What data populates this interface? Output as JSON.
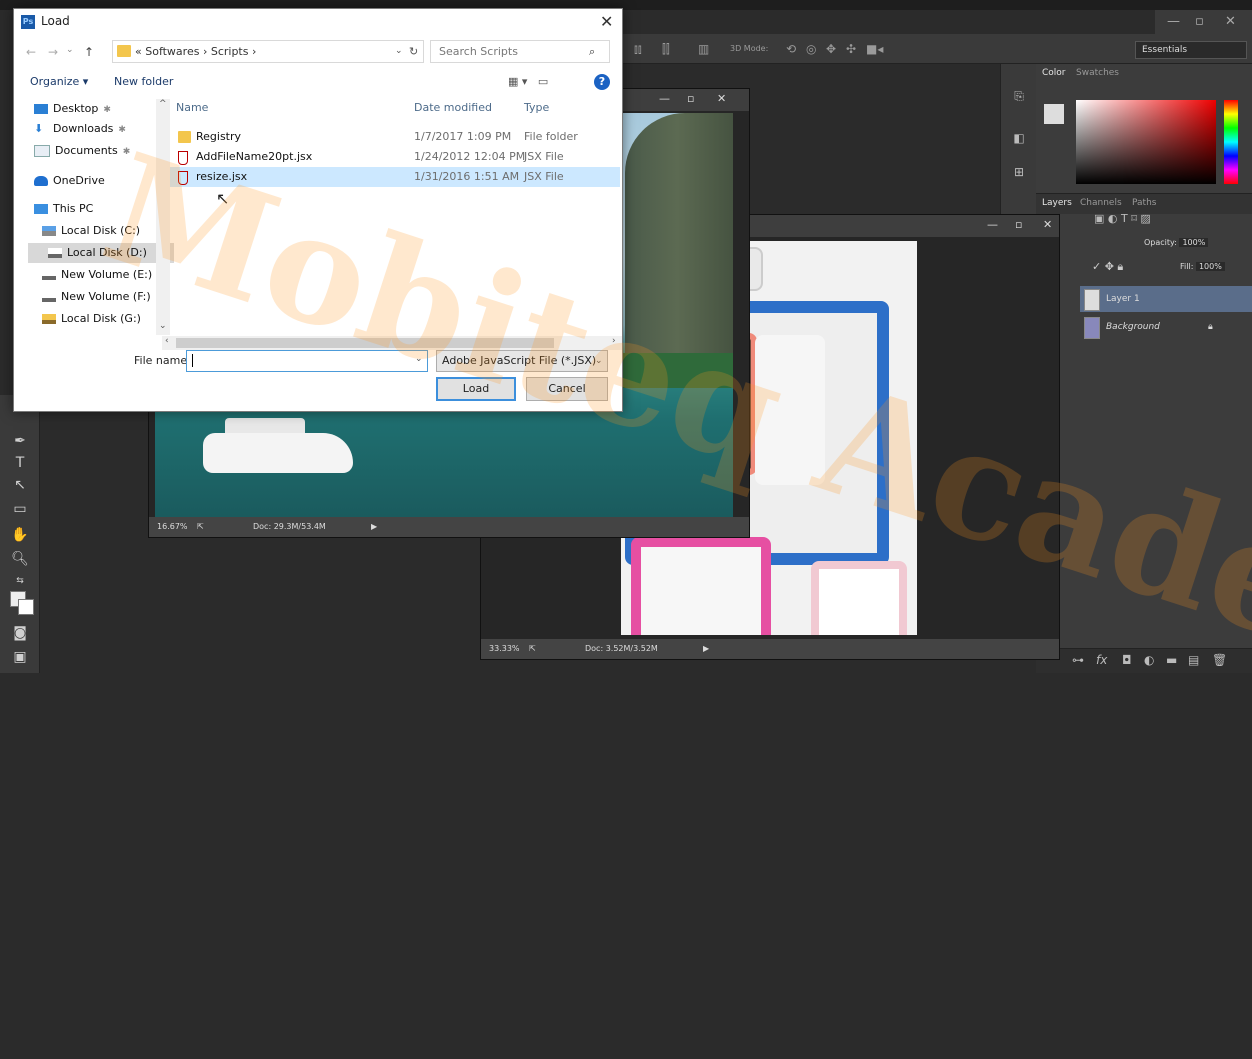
{
  "dialog": {
    "title": "Load",
    "app_icon_text": "Ps",
    "address_path": "« Softwares › Scripts ›",
    "search_placeholder": "Search Scripts",
    "organize_label": "Organize ▾",
    "new_folder_label": "New folder",
    "nav_items": [
      {
        "label": "Desktop"
      },
      {
        "label": "Downloads"
      },
      {
        "label": "Documents"
      },
      {
        "label": "OneDrive"
      },
      {
        "label": "This PC"
      },
      {
        "label": "Local Disk (C:)"
      },
      {
        "label": "Local Disk (D:)"
      },
      {
        "label": "New Volume (E:)"
      },
      {
        "label": "New Volume (F:)"
      },
      {
        "label": "Local Disk (G:)"
      }
    ],
    "columns": {
      "name": "Name",
      "date": "Date modified",
      "type": "Type"
    },
    "files": [
      {
        "name": "Registry",
        "date": "1/7/2017 1:09 PM",
        "type": "File folder"
      },
      {
        "name": "AddFileName20pt.jsx",
        "date": "1/24/2012 12:04 PM",
        "type": "JSX File"
      },
      {
        "name": "resize.jsx",
        "date": "1/31/2016 1:51 AM",
        "type": "JSX File"
      }
    ],
    "file_name_label": "File name:",
    "file_name_value": "",
    "file_type_value": "Adobe JavaScript File (*.JSX)",
    "load_label": "Load",
    "cancel_label": "Cancel"
  },
  "photoshop": {
    "workspace": "Essentials",
    "options_3d_mode": "3D Mode:",
    "color_tabs": [
      "Color",
      "Swatches"
    ],
    "layers_tabs": [
      "Layers",
      "Channels",
      "Paths"
    ],
    "opacity_label": "Opacity:",
    "opacity_value": "100%",
    "fill_label": "Fill:",
    "fill_value": "100%",
    "layers": [
      {
        "name": "Layer 1",
        "selected": true
      },
      {
        "name": "Background",
        "selected": false
      }
    ],
    "doc1_zoom": "16.67%",
    "doc1_size": "Doc: 29.3M/53.4M",
    "doc2_zoom": "33.33%",
    "doc2_size": "Doc: 3.52M/3.52M"
  },
  "watermark": "Mobiteq Academy",
  "colors": {
    "accent": "#3c8fdc",
    "selection": "#cce8ff",
    "layer_selected": "#5a6d8a"
  }
}
